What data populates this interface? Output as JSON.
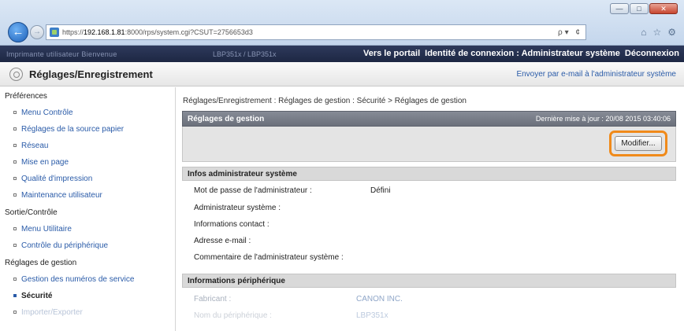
{
  "browser": {
    "url_prefix": "https://",
    "url_host": "192.168.1.81",
    "url_rest": ":8000/rps/system.cgi?CSUT=2756653d3",
    "address_tools": "ρ▾ ¢",
    "window_buttons": [
      "—",
      "□",
      "✕"
    ],
    "toolbar_icons": [
      "⌂",
      "☆",
      "⚙"
    ]
  },
  "topbar": {
    "blur_left": "Imprimante  utilisateur  Bienvenue",
    "blur_mid": "LBP351x  / LBP351x",
    "link_portal": "Vers le portail",
    "login_label": "Identité de connexion : Administrateur système",
    "logout": "Déconnexion"
  },
  "header": {
    "title": "Réglages/Enregistrement",
    "email_link": "Envoyer par e-mail à l'administrateur système"
  },
  "sidebar": {
    "sections": [
      {
        "label": "Préférences",
        "items": [
          "Menu Contrôle",
          "Réglages de la source papier",
          "Réseau",
          "Mise en page",
          "Qualité d'impression",
          "Maintenance utilisateur"
        ]
      },
      {
        "label": "Sortie/Contrôle",
        "items": [
          "Menu Utilitaire",
          "Contrôle du périphérique"
        ]
      },
      {
        "label": "Réglages de gestion",
        "items": [
          "Gestion des numéros de service",
          "Sécurité",
          "Importer/Exporter"
        ]
      }
    ]
  },
  "main": {
    "breadcrumb": "Réglages/Enregistrement : Réglages de gestion : Sécurité > Réglages de gestion",
    "panel_title": "Réglages de gestion",
    "last_update": "Dernière mise à jour : 20/08 2015 03:40:06",
    "modify_button": "Modifier...",
    "admin_section": {
      "title": "Infos administrateur système",
      "rows": [
        {
          "label": "Mot de passe de l'administrateur :",
          "value": "Défini"
        },
        {
          "label": "Administrateur système :",
          "value": ""
        },
        {
          "label": "Informations contact :",
          "value": ""
        },
        {
          "label": "Adresse e-mail :",
          "value": ""
        },
        {
          "label": "Commentaire de l'administrateur système :",
          "value": ""
        }
      ]
    },
    "device_section": {
      "title": "Informations périphérique",
      "rows": [
        {
          "label": "Fabricant :",
          "value": "CANON INC."
        },
        {
          "label": "Nom du périphérique :",
          "value": "LBP351x"
        }
      ]
    }
  }
}
